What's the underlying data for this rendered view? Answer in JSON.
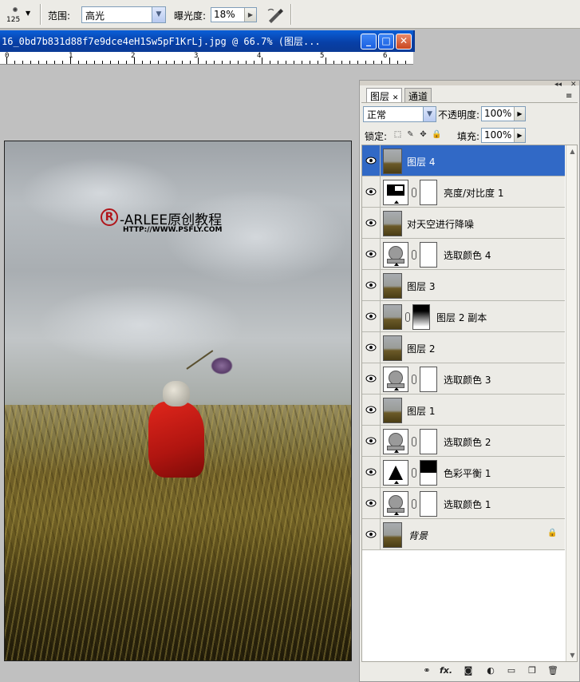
{
  "options_bar": {
    "brush_size": "125",
    "range_label": "范围:",
    "range_value": "高光",
    "exposure_label": "曝光度:",
    "exposure_value": "18%"
  },
  "document": {
    "title": "16_0bd7b831d88f7e9dce4eH1Sw5pF1KrLj.jpg @ 66.7% (图层...",
    "ruler_labels": [
      "0",
      "1",
      "2",
      "3",
      "4",
      "5",
      "6"
    ],
    "watermark": {
      "brand": "-ARLEE原创教程",
      "url": "HTTP://WWW.PSFLY.COM"
    }
  },
  "layers_panel": {
    "tabs": [
      {
        "label": "图层",
        "active": true
      },
      {
        "label": "通道",
        "active": false
      }
    ],
    "blend_mode": "正常",
    "opacity_label": "不透明度:",
    "opacity_value": "100%",
    "lock_label": "锁定:",
    "fill_label": "填充:",
    "fill_value": "100%",
    "layers": [
      {
        "name": "图层 4",
        "type": "pixel",
        "selected": true
      },
      {
        "name": "亮度/对比度 1",
        "type": "brightness-contrast",
        "mask": "white"
      },
      {
        "name": "对天空进行降噪",
        "type": "pixel"
      },
      {
        "name": "选取颜色 4",
        "type": "selective-color",
        "mask": "white"
      },
      {
        "name": "图层 3",
        "type": "pixel"
      },
      {
        "name": "图层 2 副本",
        "type": "pixel",
        "mask": "gradient"
      },
      {
        "name": "图层 2",
        "type": "pixel"
      },
      {
        "name": "选取颜色 3",
        "type": "selective-color",
        "mask": "white"
      },
      {
        "name": "图层 1",
        "type": "pixel"
      },
      {
        "name": "选取颜色 2",
        "type": "selective-color",
        "mask": "white"
      },
      {
        "name": "色彩平衡 1",
        "type": "color-balance",
        "mask": "split"
      },
      {
        "name": "选取颜色 1",
        "type": "selective-color",
        "mask": "white"
      },
      {
        "name": "背景",
        "type": "background",
        "locked": true
      }
    ],
    "footer_icons": [
      "link-icon",
      "fx-icon",
      "mask-icon",
      "adjustment-icon",
      "folder-icon",
      "new-layer-icon",
      "trash-icon"
    ]
  },
  "colors": {
    "title_bar": "#0a4fc4",
    "selected_layer": "#3169c6",
    "panel_bg": "#ecebe6"
  }
}
